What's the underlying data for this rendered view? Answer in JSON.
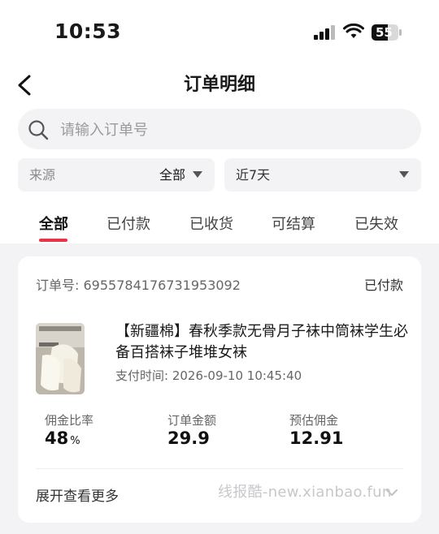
{
  "status_bar": {
    "time": "10:53",
    "battery": "55"
  },
  "nav": {
    "title": "订单明细"
  },
  "search": {
    "placeholder": "请输入订单号"
  },
  "filters": {
    "source": {
      "label": "来源",
      "value": "全部"
    },
    "date": {
      "label": "近7天"
    }
  },
  "tabs": [
    "全部",
    "已付款",
    "已收货",
    "可结算",
    "已失效"
  ],
  "active_tab": "全部",
  "order": {
    "order_no_label": "订单号:",
    "order_no": "6955784176731953092",
    "status": "已付款",
    "product_title": "【新疆棉】春秋季款无骨月子袜中筒袜学生必备百搭袜子堆堆女袜",
    "pay_time_label": "支付时间:",
    "pay_time": "2026-09-10 10:45:40",
    "metrics": {
      "commission_rate_label": "佣金比率",
      "commission_rate": "48",
      "commission_rate_unit": "%",
      "order_amount_label": "订单金额",
      "order_amount": "29.9",
      "estimated_commission_label": "预估佣金",
      "estimated_commission": "12.91"
    },
    "expand_label": "展开查看更多"
  },
  "watermark": "线报酷-new.xianbao.fun",
  "colors": {
    "accent": "#e8334a",
    "page_bg": "#f3f3f5"
  },
  "icons": [
    "signal-icon",
    "wifi-icon",
    "battery-icon",
    "back-arrow-icon",
    "search-icon",
    "caret-down-icon",
    "chevron-down-icon"
  ]
}
